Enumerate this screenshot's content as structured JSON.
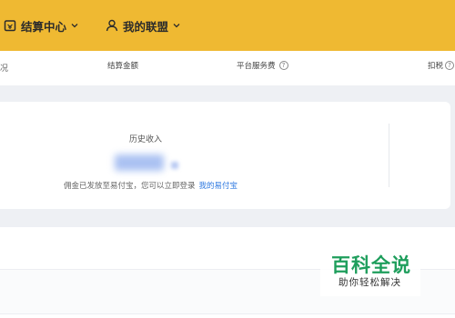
{
  "header": {
    "nav": [
      {
        "label": "结算中心",
        "icon": "wallet-icon"
      },
      {
        "label": "我的联盟",
        "icon": "user-icon"
      }
    ],
    "background": "#efb932"
  },
  "breadcrumb": "况",
  "income_card": {
    "title": "历史收入",
    "note": "佣金已发放至易付宝，您可以立即登录",
    "link": "我的易付宝",
    "link_color": "#2d78e0"
  },
  "table": {
    "columns": [
      "结算金额",
      "平台服务费",
      "扣税"
    ]
  },
  "watermark": {
    "title": "百科全说",
    "subtitle": "助你轻松解决",
    "color": "#1e9e5c"
  }
}
